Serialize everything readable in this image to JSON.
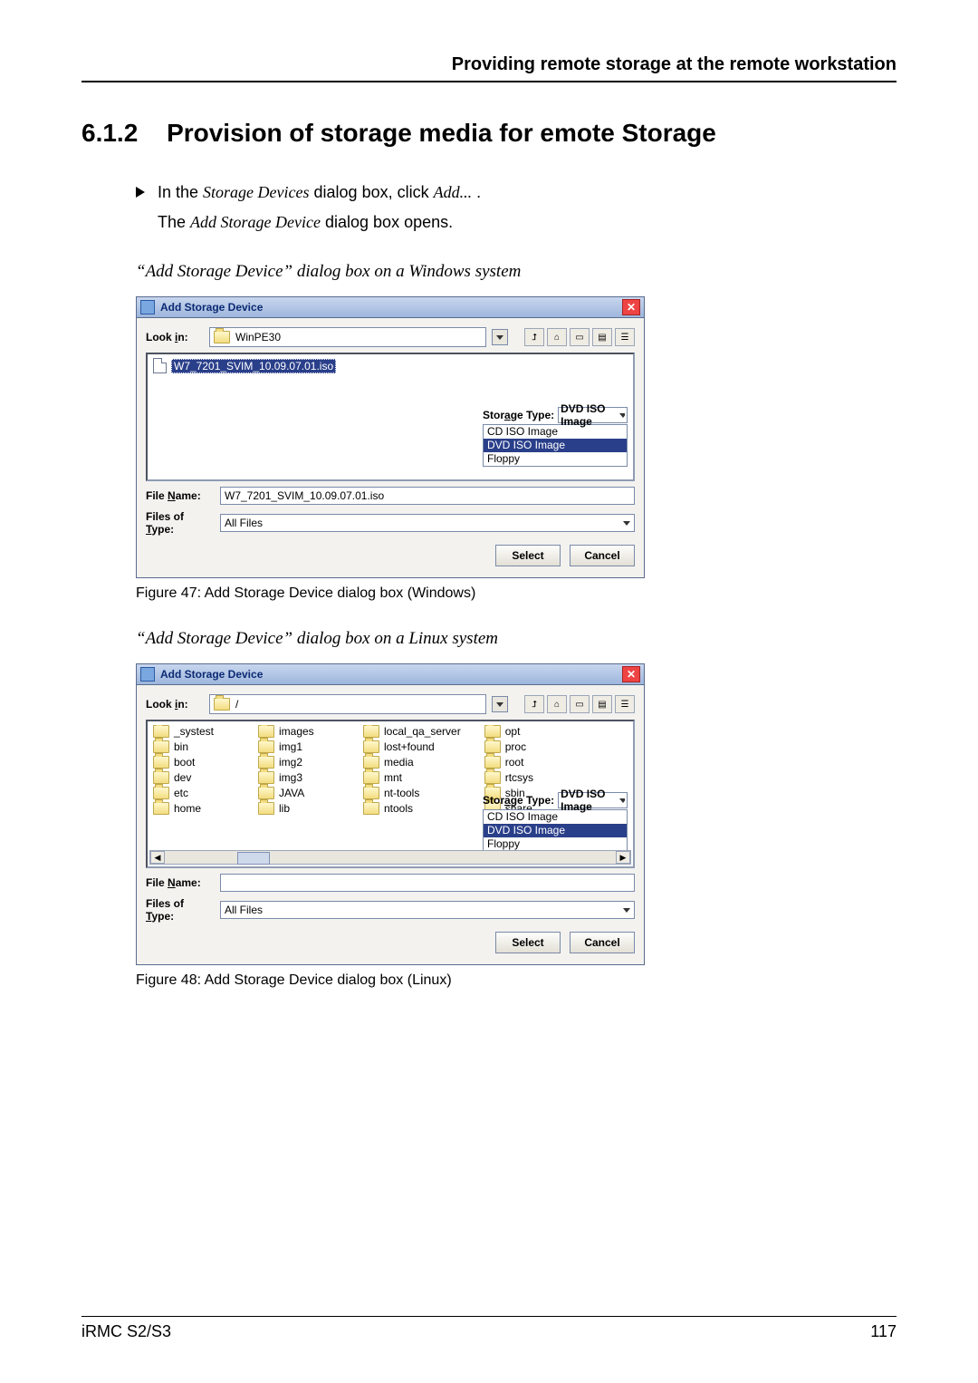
{
  "header": {
    "running": "Providing remote storage at the remote workstation"
  },
  "section": {
    "number": "6.1.2",
    "title": "Provision of storage media for emote Storage"
  },
  "intro": {
    "line1_pre": "In the ",
    "line1_ital1": "Storage Devices",
    "line1_mid": " dialog box, click ",
    "line1_ital2": "Add...",
    "line1_post": " .",
    "line2_pre": "The ",
    "line2_ital": "Add Storage Device",
    "line2_post": " dialog box opens."
  },
  "fig1": {
    "caption_above": "“Add Storage Device” dialog box on a Windows system",
    "caption_below": "Figure 47: Add Storage Device dialog box (Windows)"
  },
  "fig2": {
    "caption_above": "“Add Storage Device” dialog box on a Linux system",
    "caption_below": "Figure 48: Add Storage Device dialog box (Linux)"
  },
  "labels": {
    "lookin_pre": "Look ",
    "lookin_ul": "i",
    "lookin_post": "n:",
    "storage_pre": "Stor",
    "storage_ul": "a",
    "storage_post": "ge Type:",
    "filename_pre": "File ",
    "filename_ul": "N",
    "filename_post": "ame:",
    "filesoftype_pre": "Files of ",
    "filesoftype_ul": "T",
    "filesoftype_post": "ype:",
    "select": "Select",
    "cancel": "Cancel"
  },
  "dlg_win": {
    "title": "Add Storage Device",
    "lookin": "WinPE30",
    "file_selected": "W7_7201_SVIM_10.09.07.01.iso",
    "filename_value": "W7_7201_SVIM_10.09.07.01.iso",
    "filesoftype_value": "All Files",
    "storage_combo_value": "DVD ISO Image",
    "storage_options": [
      "CD ISO Image",
      "DVD ISO Image",
      "Floppy"
    ]
  },
  "dlg_lin": {
    "title": "Add Storage Device",
    "lookin": "/",
    "columns": [
      [
        "_systest",
        "bin",
        "boot",
        "dev",
        "etc",
        "home"
      ],
      [
        "images",
        "img1",
        "img2",
        "img3",
        "JAVA",
        "lib"
      ],
      [
        "local_qa_server",
        "lost+found",
        "media",
        "mnt",
        "nt-tools",
        "ntools"
      ],
      [
        "opt",
        "proc",
        "root",
        "rtcsys",
        "sbin",
        "share"
      ]
    ],
    "filename_value": "",
    "filesoftype_value": "All Files",
    "storage_combo_value": "DVD ISO Image",
    "storage_options": [
      "CD ISO Image",
      "DVD ISO Image",
      "Floppy"
    ]
  },
  "footer": {
    "left": "iRMC S2/S3",
    "page": "117"
  }
}
